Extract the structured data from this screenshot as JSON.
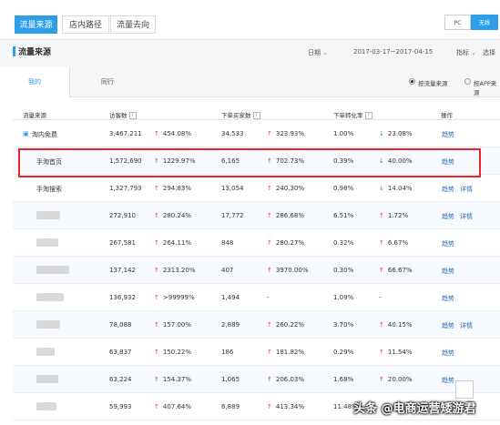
{
  "top_tabs": [
    "流量来源",
    "店内路径",
    "流量去向"
  ],
  "device_toggle": [
    "PC",
    "无线"
  ],
  "section_title": "流量来源",
  "header": {
    "date_label": "日期",
    "date_range": "2017-03-17~2017-04-15",
    "metric_label": "指标",
    "extra": "选择"
  },
  "sub_tabs": [
    "我的",
    "同行"
  ],
  "radio_options": [
    "按流量来源",
    "按APP来源"
  ],
  "columns": [
    "流量来源",
    "访客数",
    "下单买家数",
    "下单转化率",
    "操作"
  ],
  "rows": [
    {
      "source": "淘内免费",
      "visitors": "3,467,211",
      "visitors_change": "454.08%",
      "buyers": "34,533",
      "buyers_change": "323.93%",
      "conversion": "1.00%",
      "conversion_change": "23.08%",
      "conv_dir": "down",
      "actions": [
        "趋势"
      ]
    },
    {
      "source": "手淘首页",
      "visitors": "1,572,690",
      "visitors_change": "1229.97%",
      "buyers": "6,165",
      "buyers_change": "702.73%",
      "conversion": "0.39%",
      "conversion_change": "40.00%",
      "conv_dir": "down",
      "actions": [
        "趋势"
      ]
    },
    {
      "source": "手淘搜索",
      "visitors": "1,327,793",
      "visitors_change": "294.83%",
      "buyers": "13,054",
      "buyers_change": "240.30%",
      "conversion": "0.98%",
      "conversion_change": "14.04%",
      "conv_dir": "down",
      "actions": [
        "趋势",
        "详情"
      ]
    },
    {
      "source": "",
      "visitors": "272,910",
      "visitors_change": "280.24%",
      "buyers": "17,772",
      "buyers_change": "286.68%",
      "conversion": "6.51%",
      "conversion_change": "1.72%",
      "conv_dir": "up",
      "actions": [
        "趋势",
        "详情"
      ]
    },
    {
      "source": "",
      "visitors": "267,581",
      "visitors_change": "264.11%",
      "buyers": "848",
      "buyers_change": "280.27%",
      "conversion": "0.32%",
      "conversion_change": "6.67%",
      "conv_dir": "up",
      "actions": [
        "趋势"
      ]
    },
    {
      "source": "",
      "visitors": "137,142",
      "visitors_change": "2313.20%",
      "buyers": "407",
      "buyers_change": "3970.00%",
      "conversion": "0.30%",
      "conversion_change": "66.67%",
      "conv_dir": "up",
      "actions": [
        "趋势"
      ]
    },
    {
      "source": "",
      "visitors": "136,932",
      "visitors_change": ">99999%",
      "buyers": "1,494",
      "buyers_change": "-",
      "conversion": "1.09%",
      "conversion_change": "-",
      "conv_dir": "none",
      "actions": [
        "趋势"
      ]
    },
    {
      "source": "",
      "visitors": "78,088",
      "visitors_change": "157.00%",
      "buyers": "2,889",
      "buyers_change": "260.22%",
      "conversion": "3.70%",
      "conversion_change": "40.15%",
      "conv_dir": "up",
      "actions": [
        "趋势",
        "详情"
      ]
    },
    {
      "source": "",
      "visitors": "63,837",
      "visitors_change": "150.22%",
      "buyers": "186",
      "buyers_change": "181.82%",
      "conversion": "0.29%",
      "conversion_change": "11.54%",
      "conv_dir": "up",
      "actions": [
        "趋势"
      ]
    },
    {
      "source": "",
      "visitors": "63,224",
      "visitors_change": "154.37%",
      "buyers": "1,065",
      "buyers_change": "206.03%",
      "conversion": "1.68%",
      "conversion_change": "20.00%",
      "conv_dir": "up",
      "actions": [
        "趋势"
      ]
    },
    {
      "source": "",
      "visitors": "59,993",
      "visitors_change": "407.64%",
      "buyers": "6,889",
      "buyers_change": "413.34%",
      "conversion": "11.48%",
      "conversion_change": "",
      "conv_dir": "none",
      "actions": []
    }
  ],
  "watermark": "头条 @电商运营矮游君",
  "colors": {
    "accent": "#2d9fe8",
    "up": "#e0443c",
    "down": "#27a748",
    "highlight": "#e5262b"
  }
}
